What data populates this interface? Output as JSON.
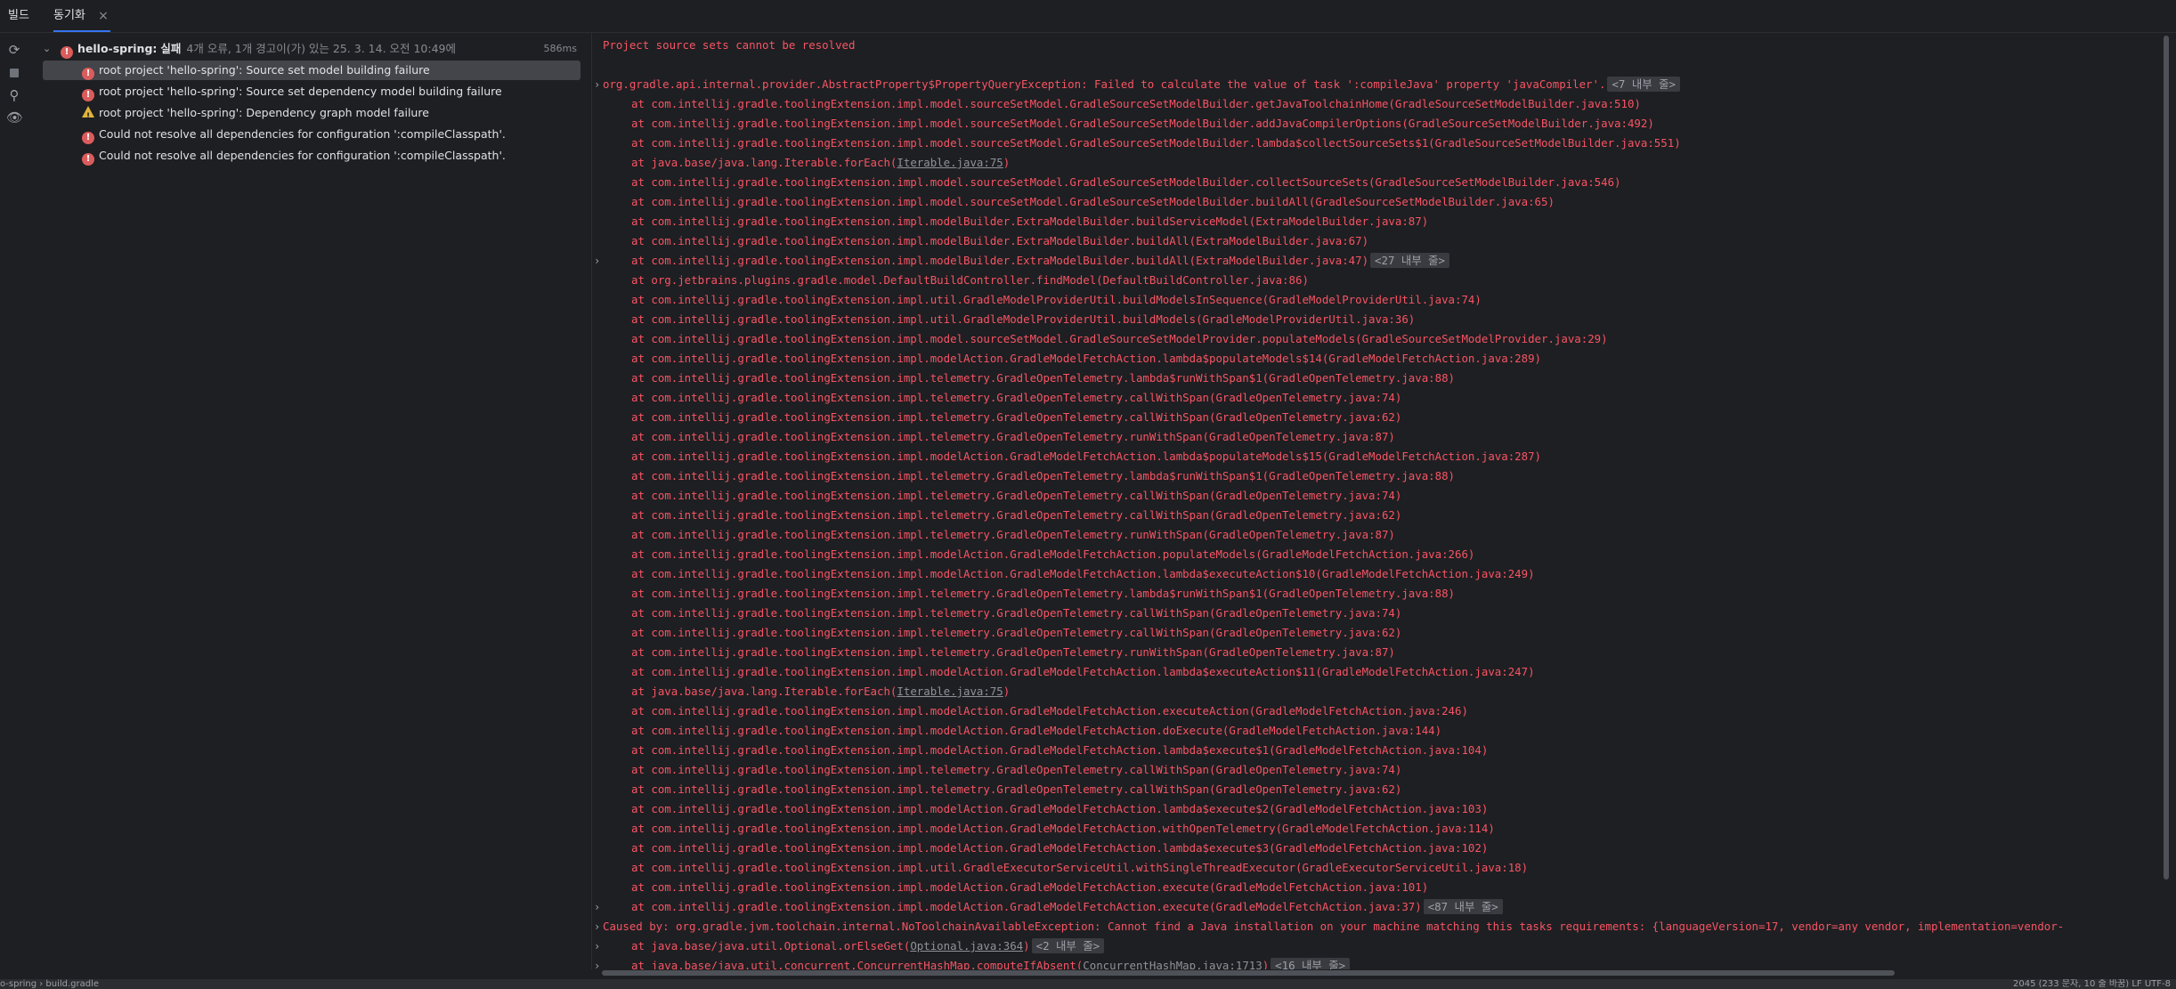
{
  "tabs": {
    "build": "빌드",
    "sync": "동기화",
    "close": "×"
  },
  "tree": {
    "root": {
      "title": "hello-spring:",
      "status": "실패",
      "summary": "4개 오류, 1개 경고이(가) 있는 25. 3. 14. 오전 10:49에",
      "time": "586ms"
    },
    "items": [
      {
        "type": "error",
        "label": "root project 'hello-spring': Source set model building failure"
      },
      {
        "type": "error",
        "label": "root project 'hello-spring': Source set dependency model building failure"
      },
      {
        "type": "warning",
        "label": "root project 'hello-spring': Dependency graph model failure"
      },
      {
        "type": "error",
        "label": "Could not resolve all dependencies for configuration ':compileClasspath'."
      },
      {
        "type": "error",
        "label": "Could not resolve all dependencies for configuration ':compileClasspath'."
      }
    ]
  },
  "console": {
    "lines": [
      {
        "text": "Project source sets cannot be resolved",
        "indent": false,
        "gutter": ""
      },
      {
        "text": "",
        "indent": false,
        "gutter": ""
      },
      {
        "text": "org.gradle.api.internal.provider.AbstractProperty$PropertyQueryException: Failed to calculate the value of task ':compileJava' property 'javaCompiler'.",
        "indent": false,
        "gutter": "›",
        "tag": "<7 내부 줄>"
      },
      {
        "text": "at com.intellij.gradle.toolingExtension.impl.model.sourceSetModel.GradleSourceSetModelBuilder.getJavaToolchainHome(GradleSourceSetModelBuilder.java:510)",
        "indent": true,
        "gutter": ""
      },
      {
        "text": "at com.intellij.gradle.toolingExtension.impl.model.sourceSetModel.GradleSourceSetModelBuilder.addJavaCompilerOptions(GradleSourceSetModelBuilder.java:492)",
        "indent": true,
        "gutter": ""
      },
      {
        "text": "at com.intellij.gradle.toolingExtension.impl.model.sourceSetModel.GradleSourceSetModelBuilder.lambda$collectSourceSets$1(GradleSourceSetModelBuilder.java:551)",
        "indent": true,
        "gutter": ""
      },
      {
        "pre": "at java.base/java.lang.Iterable.forEach(",
        "link": "Iterable.java:75",
        "post": ")",
        "indent": true,
        "gutter": ""
      },
      {
        "text": "at com.intellij.gradle.toolingExtension.impl.model.sourceSetModel.GradleSourceSetModelBuilder.collectSourceSets(GradleSourceSetModelBuilder.java:546)",
        "indent": true,
        "gutter": ""
      },
      {
        "text": "at com.intellij.gradle.toolingExtension.impl.model.sourceSetModel.GradleSourceSetModelBuilder.buildAll(GradleSourceSetModelBuilder.java:65)",
        "indent": true,
        "gutter": ""
      },
      {
        "text": "at com.intellij.gradle.toolingExtension.impl.modelBuilder.ExtraModelBuilder.buildServiceModel(ExtraModelBuilder.java:87)",
        "indent": true,
        "gutter": ""
      },
      {
        "text": "at com.intellij.gradle.toolingExtension.impl.modelBuilder.ExtraModelBuilder.buildAll(ExtraModelBuilder.java:67)",
        "indent": true,
        "gutter": ""
      },
      {
        "text": "at com.intellij.gradle.toolingExtension.impl.modelBuilder.ExtraModelBuilder.buildAll(ExtraModelBuilder.java:47)",
        "indent": true,
        "gutter": "›",
        "tag": "<27 내부 줄>"
      },
      {
        "text": "at org.jetbrains.plugins.gradle.model.DefaultBuildController.findModel(DefaultBuildController.java:86)",
        "indent": true,
        "gutter": ""
      },
      {
        "text": "at com.intellij.gradle.toolingExtension.impl.util.GradleModelProviderUtil.buildModelsInSequence(GradleModelProviderUtil.java:74)",
        "indent": true,
        "gutter": ""
      },
      {
        "text": "at com.intellij.gradle.toolingExtension.impl.util.GradleModelProviderUtil.buildModels(GradleModelProviderUtil.java:36)",
        "indent": true,
        "gutter": ""
      },
      {
        "text": "at com.intellij.gradle.toolingExtension.impl.model.sourceSetModel.GradleSourceSetModelProvider.populateModels(GradleSourceSetModelProvider.java:29)",
        "indent": true,
        "gutter": ""
      },
      {
        "text": "at com.intellij.gradle.toolingExtension.impl.modelAction.GradleModelFetchAction.lambda$populateModels$14(GradleModelFetchAction.java:289)",
        "indent": true,
        "gutter": ""
      },
      {
        "text": "at com.intellij.gradle.toolingExtension.impl.telemetry.GradleOpenTelemetry.lambda$runWithSpan$1(GradleOpenTelemetry.java:88)",
        "indent": true,
        "gutter": ""
      },
      {
        "text": "at com.intellij.gradle.toolingExtension.impl.telemetry.GradleOpenTelemetry.callWithSpan(GradleOpenTelemetry.java:74)",
        "indent": true,
        "gutter": ""
      },
      {
        "text": "at com.intellij.gradle.toolingExtension.impl.telemetry.GradleOpenTelemetry.callWithSpan(GradleOpenTelemetry.java:62)",
        "indent": true,
        "gutter": ""
      },
      {
        "text": "at com.intellij.gradle.toolingExtension.impl.telemetry.GradleOpenTelemetry.runWithSpan(GradleOpenTelemetry.java:87)",
        "indent": true,
        "gutter": ""
      },
      {
        "text": "at com.intellij.gradle.toolingExtension.impl.modelAction.GradleModelFetchAction.lambda$populateModels$15(GradleModelFetchAction.java:287)",
        "indent": true,
        "gutter": ""
      },
      {
        "text": "at com.intellij.gradle.toolingExtension.impl.telemetry.GradleOpenTelemetry.lambda$runWithSpan$1(GradleOpenTelemetry.java:88)",
        "indent": true,
        "gutter": ""
      },
      {
        "text": "at com.intellij.gradle.toolingExtension.impl.telemetry.GradleOpenTelemetry.callWithSpan(GradleOpenTelemetry.java:74)",
        "indent": true,
        "gutter": ""
      },
      {
        "text": "at com.intellij.gradle.toolingExtension.impl.telemetry.GradleOpenTelemetry.callWithSpan(GradleOpenTelemetry.java:62)",
        "indent": true,
        "gutter": ""
      },
      {
        "text": "at com.intellij.gradle.toolingExtension.impl.telemetry.GradleOpenTelemetry.runWithSpan(GradleOpenTelemetry.java:87)",
        "indent": true,
        "gutter": ""
      },
      {
        "text": "at com.intellij.gradle.toolingExtension.impl.modelAction.GradleModelFetchAction.populateModels(GradleModelFetchAction.java:266)",
        "indent": true,
        "gutter": ""
      },
      {
        "text": "at com.intellij.gradle.toolingExtension.impl.modelAction.GradleModelFetchAction.lambda$executeAction$10(GradleModelFetchAction.java:249)",
        "indent": true,
        "gutter": ""
      },
      {
        "text": "at com.intellij.gradle.toolingExtension.impl.telemetry.GradleOpenTelemetry.lambda$runWithSpan$1(GradleOpenTelemetry.java:88)",
        "indent": true,
        "gutter": ""
      },
      {
        "text": "at com.intellij.gradle.toolingExtension.impl.telemetry.GradleOpenTelemetry.callWithSpan(GradleOpenTelemetry.java:74)",
        "indent": true,
        "gutter": ""
      },
      {
        "text": "at com.intellij.gradle.toolingExtension.impl.telemetry.GradleOpenTelemetry.callWithSpan(GradleOpenTelemetry.java:62)",
        "indent": true,
        "gutter": ""
      },
      {
        "text": "at com.intellij.gradle.toolingExtension.impl.telemetry.GradleOpenTelemetry.runWithSpan(GradleOpenTelemetry.java:87)",
        "indent": true,
        "gutter": ""
      },
      {
        "text": "at com.intellij.gradle.toolingExtension.impl.modelAction.GradleModelFetchAction.lambda$executeAction$11(GradleModelFetchAction.java:247)",
        "indent": true,
        "gutter": ""
      },
      {
        "pre": "at java.base/java.lang.Iterable.forEach(",
        "link": "Iterable.java:75",
        "post": ")",
        "indent": true,
        "gutter": ""
      },
      {
        "text": "at com.intellij.gradle.toolingExtension.impl.modelAction.GradleModelFetchAction.executeAction(GradleModelFetchAction.java:246)",
        "indent": true,
        "gutter": ""
      },
      {
        "text": "at com.intellij.gradle.toolingExtension.impl.modelAction.GradleModelFetchAction.doExecute(GradleModelFetchAction.java:144)",
        "indent": true,
        "gutter": ""
      },
      {
        "text": "at com.intellij.gradle.toolingExtension.impl.modelAction.GradleModelFetchAction.lambda$execute$1(GradleModelFetchAction.java:104)",
        "indent": true,
        "gutter": ""
      },
      {
        "text": "at com.intellij.gradle.toolingExtension.impl.telemetry.GradleOpenTelemetry.callWithSpan(GradleOpenTelemetry.java:74)",
        "indent": true,
        "gutter": ""
      },
      {
        "text": "at com.intellij.gradle.toolingExtension.impl.telemetry.GradleOpenTelemetry.callWithSpan(GradleOpenTelemetry.java:62)",
        "indent": true,
        "gutter": ""
      },
      {
        "text": "at com.intellij.gradle.toolingExtension.impl.modelAction.GradleModelFetchAction.lambda$execute$2(GradleModelFetchAction.java:103)",
        "indent": true,
        "gutter": ""
      },
      {
        "text": "at com.intellij.gradle.toolingExtension.impl.modelAction.GradleModelFetchAction.withOpenTelemetry(GradleModelFetchAction.java:114)",
        "indent": true,
        "gutter": ""
      },
      {
        "text": "at com.intellij.gradle.toolingExtension.impl.modelAction.GradleModelFetchAction.lambda$execute$3(GradleModelFetchAction.java:102)",
        "indent": true,
        "gutter": ""
      },
      {
        "text": "at com.intellij.gradle.toolingExtension.impl.util.GradleExecutorServiceUtil.withSingleThreadExecutor(GradleExecutorServiceUtil.java:18)",
        "indent": true,
        "gutter": ""
      },
      {
        "text": "at com.intellij.gradle.toolingExtension.impl.modelAction.GradleModelFetchAction.execute(GradleModelFetchAction.java:101)",
        "indent": true,
        "gutter": ""
      },
      {
        "text": "at com.intellij.gradle.toolingExtension.impl.modelAction.GradleModelFetchAction.execute(GradleModelFetchAction.java:37)",
        "indent": true,
        "gutter": "›",
        "tag": "<87 내부 줄>"
      },
      {
        "text": "Caused by: org.gradle.jvm.toolchain.internal.NoToolchainAvailableException: Cannot find a Java installation on your machine matching this tasks requirements: {languageVersion=17, vendor=any vendor, implementation=vendor-",
        "indent": false,
        "gutter": "›"
      },
      {
        "pre": "at java.base/java.util.Optional.orElseGet(",
        "link": "Optional.java:364",
        "post": ")",
        "indent": true,
        "gutter": "›",
        "tag": "<2 내부 줄>"
      },
      {
        "pre": "at java.base/java.util.concurrent.ConcurrentHashMap.computeIfAbsent(",
        "link": "ConcurrentHashMap.java:1713",
        "post": ")",
        "indent": true,
        "gutter": "›",
        "tag": "<16 내부 줄>"
      }
    ]
  },
  "statusbar": {
    "left": "o-spring  ›  build.gradle",
    "right": "2045 (233 문자, 10 줄 바꿈)   LF   UTF-8"
  },
  "colors": {
    "error_text": "#f75464",
    "accent": "#3574f0",
    "background": "#1e1f22"
  }
}
